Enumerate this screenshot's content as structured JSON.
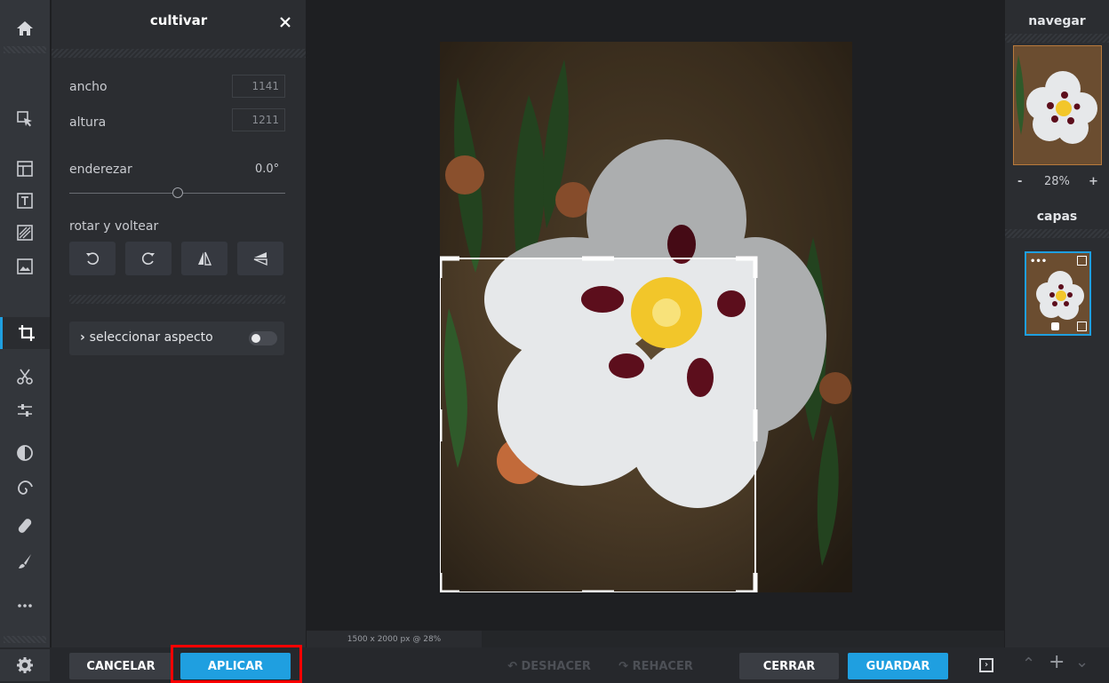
{
  "toolrail": {
    "tools": [
      "home-icon",
      "pointer-icon",
      "layout-icon",
      "text-icon",
      "pattern-icon",
      "image-icon",
      "crop-icon",
      "cut-icon",
      "adjust-icon",
      "contrast-icon",
      "spiral-icon",
      "bandage-icon",
      "brush-icon",
      "more-icon"
    ],
    "settings": "gear-icon"
  },
  "panel": {
    "title": "cultivar",
    "width_label": "ancho",
    "width_value": "1141",
    "height_label": "altura",
    "height_value": "1211",
    "straighten_label": "enderezar",
    "straighten_value": "0.0°",
    "straighten_level": 0.5,
    "rotate_label": "rotar y voltear",
    "rotate_buttons": [
      "rotate-left-icon",
      "rotate-right-icon",
      "flip-horizontal-icon",
      "flip-vertical-icon"
    ],
    "aspect_label": "seleccionar aspecto",
    "aspect_toggle": false
  },
  "bottom": {
    "cancel": "CANCELAR",
    "apply": "APLICAR",
    "undo": "DESHACER",
    "redo": "REHACER",
    "close": "CERRAR",
    "save": "GUARDAR",
    "plus": "+"
  },
  "canvas": {
    "status": "1500 x 2000 px @ 28%"
  },
  "right": {
    "navigate_title": "navegar",
    "zoom_minus": "-",
    "zoom_value": "28%",
    "zoom_plus": "+",
    "layers_title": "capas",
    "layer_more": "•••"
  },
  "colors": {
    "accent": "#1f9fe0",
    "highlight": "#ff0000"
  }
}
